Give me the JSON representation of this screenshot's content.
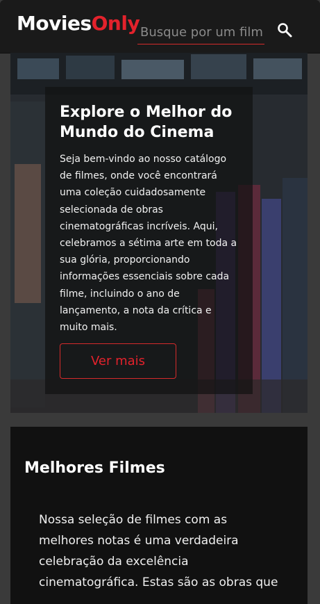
{
  "header": {
    "brand_part1": "Movies",
    "brand_part2": "Only",
    "search_placeholder": "Busque por um filme",
    "search_icon": "search-icon"
  },
  "hero": {
    "title": "Explore o Melhor do Mundo do Cinema",
    "text": "Seja bem-vindo ao nosso catálogo de filmes, onde você encontrará uma coleção cuidadosamente selecionada de obras cinematográficas incríveis. Aqui, celebramos a sétima arte em toda a sua glória, proporcionando informações essenciais sobre cada filme, incluindo o ano de lançamento, a nota da crítica e muito mais.",
    "button_label": "Ver mais"
  },
  "best": {
    "title": "Melhores Filmes",
    "text": "Nossa seleção de filmes com as melhores notas é uma verdadeira celebração da excelência cinematográfica. Estas são as obras que"
  },
  "colors": {
    "accent": "#e3222c",
    "header_bg": "#1a1a1a",
    "section_bg": "#111111"
  }
}
